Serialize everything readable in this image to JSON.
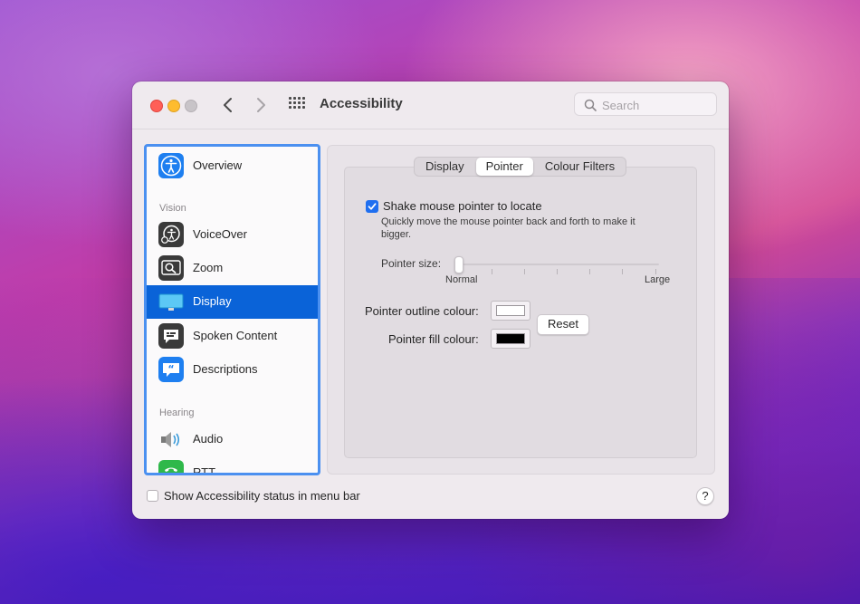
{
  "window": {
    "title": "Accessibility"
  },
  "search": {
    "placeholder": "Search"
  },
  "sidebar": {
    "items": [
      {
        "label": "Overview",
        "icon": "accessibility-icon",
        "color": "#1e7ff0"
      },
      {
        "label": "VoiceOver",
        "icon": "voiceover-icon",
        "color": "#3a3a3a"
      },
      {
        "label": "Zoom",
        "icon": "zoom-icon",
        "color": "#3a3a3a"
      },
      {
        "label": "Display",
        "icon": "display-icon",
        "color": "#2aa6e8",
        "selected": true
      },
      {
        "label": "Spoken Content",
        "icon": "speech-bubble-icon",
        "color": "#3a3a3a"
      },
      {
        "label": "Descriptions",
        "icon": "quote-bubble-icon",
        "color": "#1e7ff0"
      },
      {
        "label": "Audio",
        "icon": "speaker-icon",
        "color": "#8a8a8a"
      },
      {
        "label": "RTT",
        "icon": "phone-icon",
        "color": "#2fb84a"
      }
    ],
    "sections": {
      "vision": "Vision",
      "hearing": "Hearing"
    }
  },
  "tabs": [
    {
      "label": "Display",
      "active": false
    },
    {
      "label": "Pointer",
      "active": true
    },
    {
      "label": "Colour Filters",
      "active": false
    }
  ],
  "pointer": {
    "shake_label": "Shake mouse pointer to locate",
    "shake_checked": true,
    "shake_description": "Quickly move the mouse pointer back and forth to make it bigger.",
    "size_label": "Pointer size:",
    "size_min_label": "Normal",
    "size_max_label": "Large",
    "size_value": 0,
    "outline_label": "Pointer outline colour:",
    "outline_color": "#ffffff",
    "fill_label": "Pointer fill colour:",
    "fill_color": "#000000",
    "reset_label": "Reset"
  },
  "footer": {
    "status_label": "Show Accessibility status in menu bar",
    "status_checked": false,
    "help_label": "?"
  }
}
